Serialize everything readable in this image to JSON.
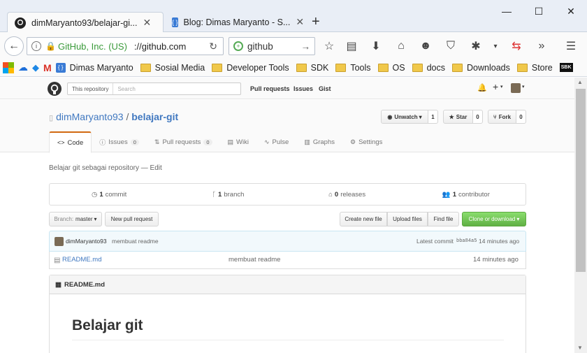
{
  "browser": {
    "tabs": [
      {
        "title": "dimMaryanto93/belajar-gi...",
        "active": true
      },
      {
        "title": "Blog: Dimas Maryanto - S...",
        "active": false
      }
    ],
    "new_tab": "+",
    "window_controls": {
      "minimize": "—",
      "maximize": "☐",
      "close": "✕"
    },
    "url_identity": "GitHub, Inc. (US)",
    "url": "://github.com",
    "search_value": "github",
    "bookmarks": [
      {
        "label": "Dimas Maryanto",
        "icon": "json-icon"
      },
      {
        "label": "Sosial Media",
        "icon": "folder-icon"
      },
      {
        "label": "Developer Tools",
        "icon": "folder-icon"
      },
      {
        "label": "SDK",
        "icon": "folder-icon"
      },
      {
        "label": "Tools",
        "icon": "folder-icon"
      },
      {
        "label": "OS",
        "icon": "folder-icon"
      },
      {
        "label": "docs",
        "icon": "folder-icon"
      },
      {
        "label": "Downloads",
        "icon": "folder-icon"
      },
      {
        "label": "Store",
        "icon": "folder-icon"
      }
    ],
    "bookmark_extra_badge": "SBK"
  },
  "github": {
    "search_scope": "This repository",
    "search_placeholder": "Search",
    "nav": [
      "Pull requests",
      "Issues",
      "Gist"
    ],
    "add_menu": "+",
    "repo": {
      "owner": "dimMaryanto93",
      "separator": "/",
      "name": "belajar-git",
      "watch_label": "Unwatch",
      "watch_count": "1",
      "star_label": "Star",
      "star_count": "0",
      "fork_label": "Fork",
      "fork_count": "0"
    },
    "tabs": [
      {
        "label": "Code",
        "icon": "<>",
        "count": null,
        "selected": true
      },
      {
        "label": "Issues",
        "icon": "ⓘ",
        "count": "0",
        "selected": false
      },
      {
        "label": "Pull requests",
        "icon": "⇅",
        "count": "0",
        "selected": false
      },
      {
        "label": "Wiki",
        "icon": "▤",
        "count": null,
        "selected": false
      },
      {
        "label": "Pulse",
        "icon": "∿",
        "count": null,
        "selected": false
      },
      {
        "label": "Graphs",
        "icon": "▥",
        "count": null,
        "selected": false
      },
      {
        "label": "Settings",
        "icon": "⚙",
        "count": null,
        "selected": false
      }
    ],
    "description": "Belajar git sebagai repository",
    "description_sep": "—",
    "edit_label": "Edit",
    "numbers": [
      {
        "count": "1",
        "label": "commit"
      },
      {
        "count": "1",
        "label": "branch"
      },
      {
        "count": "0",
        "label": "releases"
      },
      {
        "count": "1",
        "label": "contributor"
      }
    ],
    "branch_prefix": "Branch:",
    "branch_name": "master",
    "new_pull_request": "New pull request",
    "file_buttons": [
      "Create new file",
      "Upload files",
      "Find file"
    ],
    "clone_button": "Clone or download",
    "latest_commit": {
      "author": "dimMaryanto93",
      "message": "membuat readme",
      "label": "Latest commit",
      "sha": "bba84a5",
      "time": "14 minutes ago"
    },
    "files": [
      {
        "name": "README.md",
        "message": "membuat readme",
        "time": "14 minutes ago"
      }
    ],
    "readme": {
      "title": "README.md",
      "heading": "Belajar git"
    }
  }
}
